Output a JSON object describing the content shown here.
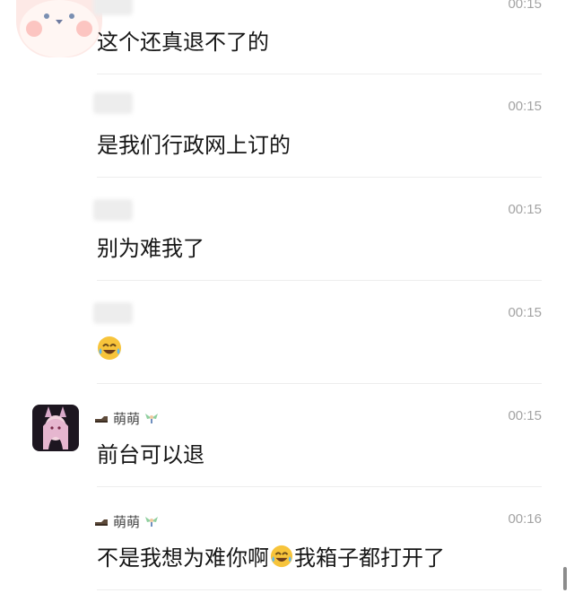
{
  "messages": [
    {
      "id": 1,
      "time": "00:15",
      "text": "这个还真退不了的"
    },
    {
      "id": 2,
      "time": "00:15",
      "text": "是我们行政网上订的"
    },
    {
      "id": 3,
      "time": "00:15",
      "text": "别为难我了"
    },
    {
      "id": 4,
      "time": "00:15",
      "text": "",
      "emoji": "laughing-crying-emoji"
    },
    {
      "id": 5,
      "time": "00:15",
      "sender": "萌萌",
      "text": "前台可以退"
    },
    {
      "id": 6,
      "time": "00:16",
      "sender": "萌萌",
      "text_before": "不是我想为难你啊",
      "emoji": "laughing-crying-emoji",
      "text_after": "我箱子都打开了"
    }
  ],
  "colors": {
    "time": "#a3a3a3",
    "divider": "#ededed",
    "text": "#161616"
  }
}
